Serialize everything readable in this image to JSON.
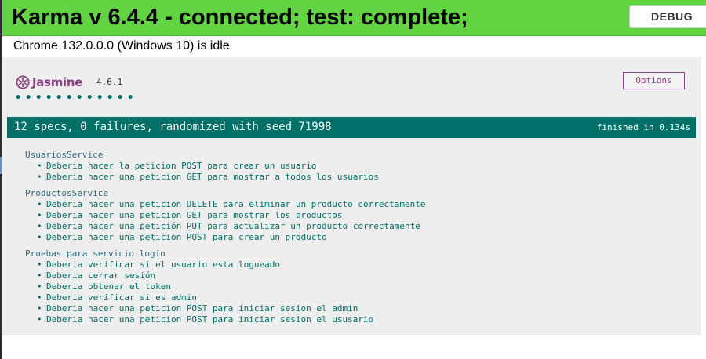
{
  "banner": {
    "title": "Karma v 6.4.4 - connected; test: complete;",
    "debug_label": "DEBUG"
  },
  "browser_status": "Chrome 132.0.0.0 (Windows 10) is idle",
  "jasmine": {
    "logo_text": "Jasmine",
    "version": "4.6.1",
    "options_label": "Options",
    "dot_count": 12,
    "summary": "12 specs, 0 failures, randomized with seed 71998",
    "finished": "finished in 0.134s",
    "colors": {
      "passed": "#007069",
      "brand": "#8a4182",
      "banner": "#62d442"
    },
    "suites": [
      {
        "name": "UsuariosService",
        "specs": [
          "Deberia hacer la peticion POST para crear un usuario",
          "Deberia hacer una peticion GET para mostrar a todos los usuarios"
        ]
      },
      {
        "name": "ProductosService",
        "specs": [
          "Deberia hacer una peticion DELETE para eliminar un producto correctamente",
          "Deberia hacer una peticion GET para mostrar los productos",
          "Deberia hacer una petición PUT para actualizar un producto correctamente",
          "Deberia hacer una peticion POST para crear un producto"
        ]
      },
      {
        "name": "Pruebas para servicio login",
        "specs": [
          "Deberia verificar si el usuario esta logueado",
          "Deberia cerrar sesión",
          "Deberia obtener el token",
          "Deberia verificar si es admin",
          "Deberia hacer una peticion POST para iniciar sesion el admin",
          "Deberia hacer una peticion POST para iniciar sesion el ususario"
        ]
      }
    ]
  }
}
